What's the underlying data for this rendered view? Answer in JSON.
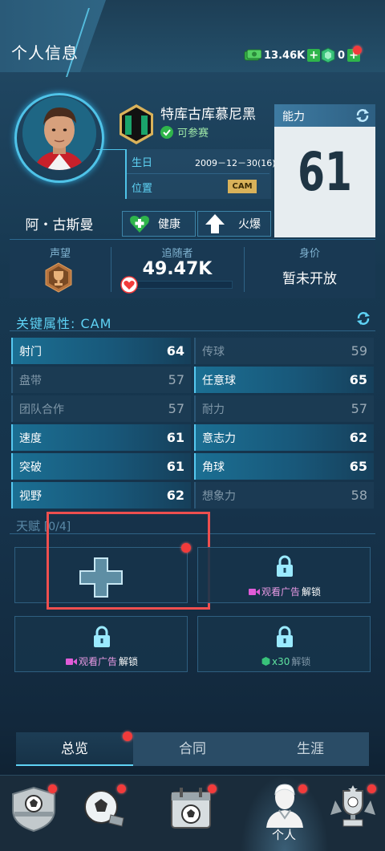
{
  "header": {
    "title": "个人信息",
    "currency_value": "13.46K",
    "gem_value": "0"
  },
  "player": {
    "name": "阿・古斯曼",
    "team": "特库古库慕尼黑",
    "eligibility": "可参赛",
    "birth_label": "生日",
    "birth_value": "2009－12－30(16)",
    "position_label": "位置",
    "position_value": "CAM",
    "health_label": "健康",
    "form_label": "火爆"
  },
  "ability": {
    "label": "能力",
    "value": "61"
  },
  "strip": {
    "reputation_label": "声望",
    "followers_label": "追随者",
    "followers_value": "49.47K",
    "followers_progress": 0.05,
    "worth_label": "身价",
    "worth_value": "暂未开放"
  },
  "attributes": {
    "title": "关键属性: CAM",
    "items": [
      {
        "name": "射门",
        "value": "64",
        "hi": true
      },
      {
        "name": "传球",
        "value": "59",
        "hi": false
      },
      {
        "name": "盘带",
        "value": "57",
        "hi": false
      },
      {
        "name": "任意球",
        "value": "65",
        "hi": true
      },
      {
        "name": "团队合作",
        "value": "57",
        "hi": false
      },
      {
        "name": "耐力",
        "value": "57",
        "hi": false
      },
      {
        "name": "速度",
        "value": "61",
        "hi": true
      },
      {
        "name": "意志力",
        "value": "62",
        "hi": true
      },
      {
        "name": "突破",
        "value": "61",
        "hi": true
      },
      {
        "name": "角球",
        "value": "65",
        "hi": true
      },
      {
        "name": "视野",
        "value": "62",
        "hi": true
      },
      {
        "name": "想象力",
        "value": "58",
        "hi": false
      }
    ]
  },
  "talent": {
    "title": "天赋",
    "count": "[0/4]",
    "watch_ad": "观看广告",
    "unlock": "解锁",
    "x30": "x30"
  },
  "tabs": [
    "总览",
    "合同",
    "生涯"
  ],
  "nav": {
    "active_label": "个人"
  },
  "colors": {
    "accent": "#5fd3f5",
    "red_dot": "#f23b3b",
    "green": "#2fb54b",
    "cam_badge": "#d9b25a"
  }
}
